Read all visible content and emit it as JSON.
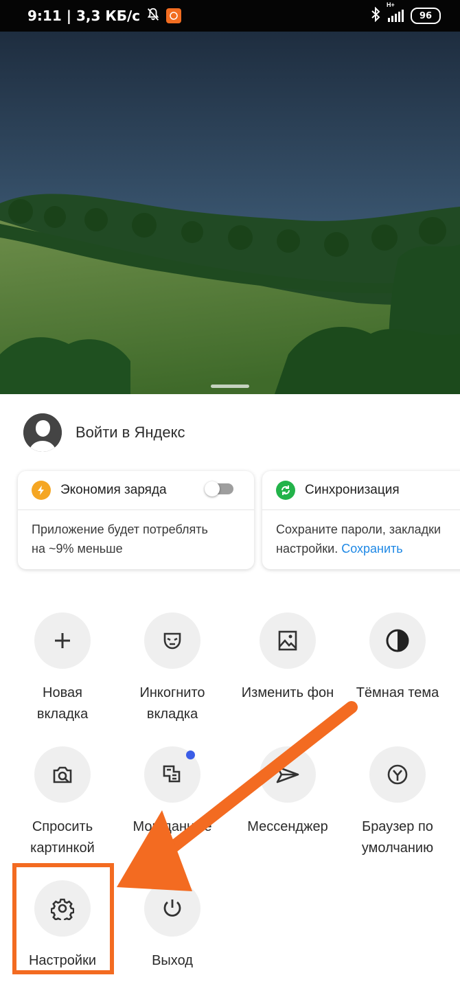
{
  "status_bar": {
    "left_text": "9:11 | 3,3 КБ/с",
    "network": "H+",
    "battery": "96"
  },
  "login": {
    "label": "Войти в Яндекс"
  },
  "cards": [
    {
      "title": "Экономия заряда",
      "line1": "Приложение будет потреблять",
      "line2": "на ~9% меньше"
    },
    {
      "title": "Синхронизация",
      "line1": "Сохраните пароли, закладки",
      "line2_prefix": "настройки. ",
      "link": "Сохранить"
    }
  ],
  "actions": [
    {
      "label": "Новая\nвкладка",
      "icon": "plus-icon"
    },
    {
      "label": "Инкогнито\nвкладка",
      "icon": "mask-icon"
    },
    {
      "label": "Изменить фон",
      "icon": "image-icon"
    },
    {
      "label": "Тёмная тема",
      "icon": "contrast-icon"
    },
    {
      "label": "Спросить\nкартинкой",
      "icon": "camera-search-icon"
    },
    {
      "label": "Мои данные",
      "icon": "my-data-icon"
    },
    {
      "label": "Мессенджер",
      "icon": "paper-plane-icon"
    },
    {
      "label": "Браузер по\nумолчанию",
      "icon": "default-browser-icon"
    },
    {
      "label": "Настройки",
      "icon": "gear-icon"
    },
    {
      "label": "Выход",
      "icon": "power-icon"
    }
  ],
  "colors": {
    "accent_orange": "#f36b21",
    "link_blue": "#1e88e5",
    "sync_green": "#23b34a",
    "battery_icon_orange": "#f5a623",
    "notification_dot": "#3b5de7"
  }
}
